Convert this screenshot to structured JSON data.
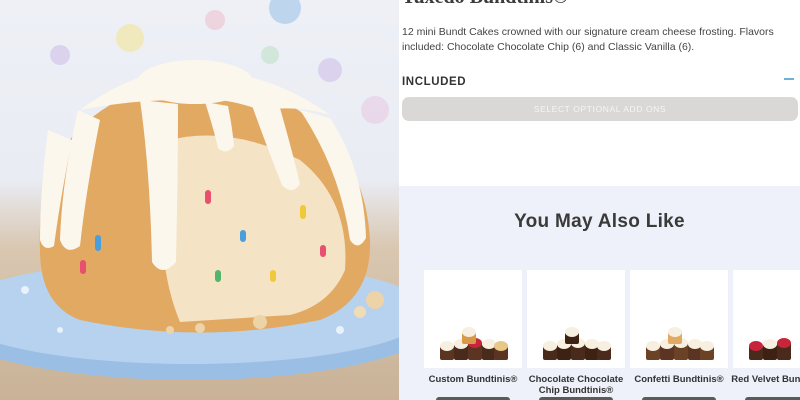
{
  "product": {
    "title": "Tuxedo Bundtinis®",
    "description": "12 mini Bundt Cakes crowned with our signature cream cheese frosting. Flavors included: Chocolate Chocolate Chip (6) and Classic Vanilla (6).",
    "included_label": "INCLUDED",
    "addons_button": "SELECT OPTIONAL ADD ONS"
  },
  "recommendations": {
    "title": "You May Also Like",
    "items": [
      {
        "name": "Custom Bundtinis®"
      },
      {
        "name": "Chocolate Chocolate Chip Bundtinis®"
      },
      {
        "name": "Confetti Bundtinis®"
      },
      {
        "name": "Red Velvet Bundtinis®"
      }
    ]
  },
  "colors": {
    "accent": "#6fb1d9",
    "addons_button_bg": "#dad8d6",
    "section_bg": "#eef1f9"
  }
}
